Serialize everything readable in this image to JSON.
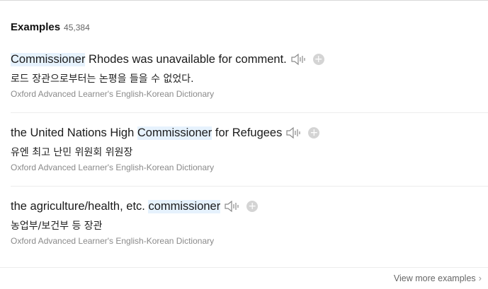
{
  "section": {
    "title": "Examples",
    "count": "45,384"
  },
  "examples": [
    {
      "pre": "",
      "term": "Commissioner",
      "post": " Rhodes was unavailable for comment.",
      "translation": "로드 장관으로부터는 논평을 들을 수 없었다.",
      "source": "Oxford Advanced Learner's English-Korean Dictionary"
    },
    {
      "pre": "the United Nations High ",
      "term": "Commissioner",
      "post": " for Refugees",
      "translation": "유엔 최고 난민 위원회 위원장",
      "source": "Oxford Advanced Learner's English-Korean Dictionary"
    },
    {
      "pre": "the agriculture/health, etc. ",
      "term": "commissioner",
      "post": "",
      "translation": "농업부/보건부 등 장관",
      "source": "Oxford Advanced Learner's English-Korean Dictionary"
    }
  ],
  "view_more": {
    "label": "View more examples",
    "icon": "chevron-right-icon"
  },
  "colors": {
    "highlight": "#e6f2fd",
    "icon_gray": "#d4d4d4"
  }
}
